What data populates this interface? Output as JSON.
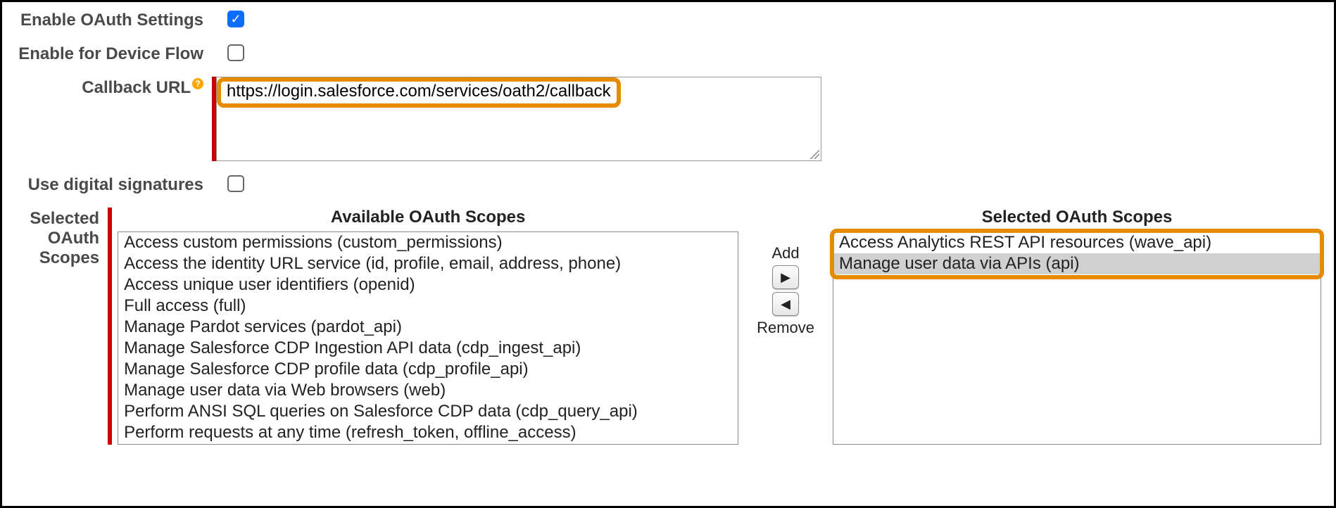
{
  "fields": {
    "enable_oauth": {
      "label": "Enable OAuth Settings",
      "checked": true
    },
    "device_flow": {
      "label": "Enable for Device Flow",
      "checked": false
    },
    "callback_url": {
      "label": "Callback URL",
      "value": "https://login.salesforce.com/services/oath2/callback"
    },
    "digital_sig": {
      "label": "Use digital signatures",
      "checked": false
    },
    "scopes": {
      "label": "Selected OAuth Scopes"
    }
  },
  "picker": {
    "available_heading": "Available OAuth Scopes",
    "selected_heading": "Selected OAuth Scopes",
    "add_label": "Add",
    "remove_label": "Remove",
    "available": [
      "Access custom permissions (custom_permissions)",
      "Access the identity URL service (id, profile, email, address, phone)",
      "Access unique user identifiers (openid)",
      "Full access (full)",
      "Manage Pardot services (pardot_api)",
      "Manage Salesforce CDP Ingestion API data (cdp_ingest_api)",
      "Manage Salesforce CDP profile data (cdp_profile_api)",
      "Manage user data via Web browsers (web)",
      "Perform ANSI SQL queries on Salesforce CDP data (cdp_query_api)",
      "Perform requests at any time (refresh_token, offline_access)"
    ],
    "selected": [
      {
        "text": "Access Analytics REST API resources (wave_api)",
        "highlighted": false
      },
      {
        "text": "Manage user data via APIs (api)",
        "highlighted": true
      }
    ]
  },
  "colors": {
    "highlight": "#e68a00",
    "required": "#c00",
    "checkbox_checked": "#0d6efd"
  }
}
